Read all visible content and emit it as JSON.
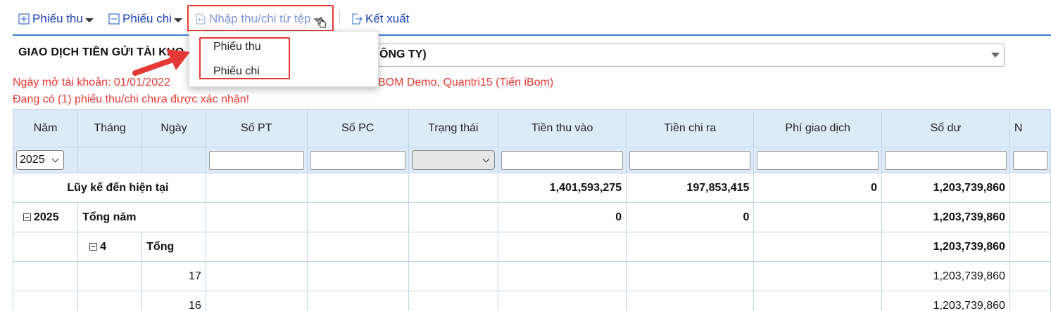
{
  "toolbar": {
    "receipt_label": "Phiếu thu",
    "payment_label": "Phiếu chi",
    "import_label": "Nhập thu/chi từ tệp",
    "export_label": "Kết xuất"
  },
  "import_menu": {
    "items": [
      "Phiếu thu",
      "Phiếu chi"
    ]
  },
  "account": {
    "title": "GIAO DỊCH TIỀN GỬI TÀI KHO",
    "selected_value": "ÔNG TY)"
  },
  "info": {
    "open_date_line": "Ngày mở tài khoản: 01/01/2022",
    "users_line": "BOM Demo, Quantri15 (Tiến iBom)",
    "pending_line": "Đang có (1) phiếu thu/chi chưa được xác nhận!"
  },
  "table": {
    "columns": [
      "Năm",
      "Tháng",
      "Ngày",
      "Số PT",
      "Số PC",
      "Trạng thái",
      "Tiền thu vào",
      "Tiền chi ra",
      "Phí giao dịch",
      "Số dư",
      "N"
    ],
    "year_filter": "2025",
    "rows": [
      {
        "label": "Lũy kế đến hiện tại",
        "in": "1,401,593,275",
        "out": "197,853,415",
        "fee": "0",
        "balance": "1,203,739,860"
      },
      {
        "year": "2025",
        "label": "Tổng năm",
        "in": "0",
        "out": "0",
        "fee": "",
        "balance": "1,203,739,860"
      },
      {
        "month": "4",
        "label": "Tổng",
        "in": "",
        "out": "",
        "fee": "",
        "balance": "1,203,739,860"
      },
      {
        "day": "17",
        "balance": "1,203,739,860"
      },
      {
        "day": "16",
        "balance": "1,203,739,860"
      }
    ]
  },
  "colors": {
    "link": "#1a3fb5",
    "highlight": "#e53935",
    "header_bg": "#ddeaf8"
  }
}
